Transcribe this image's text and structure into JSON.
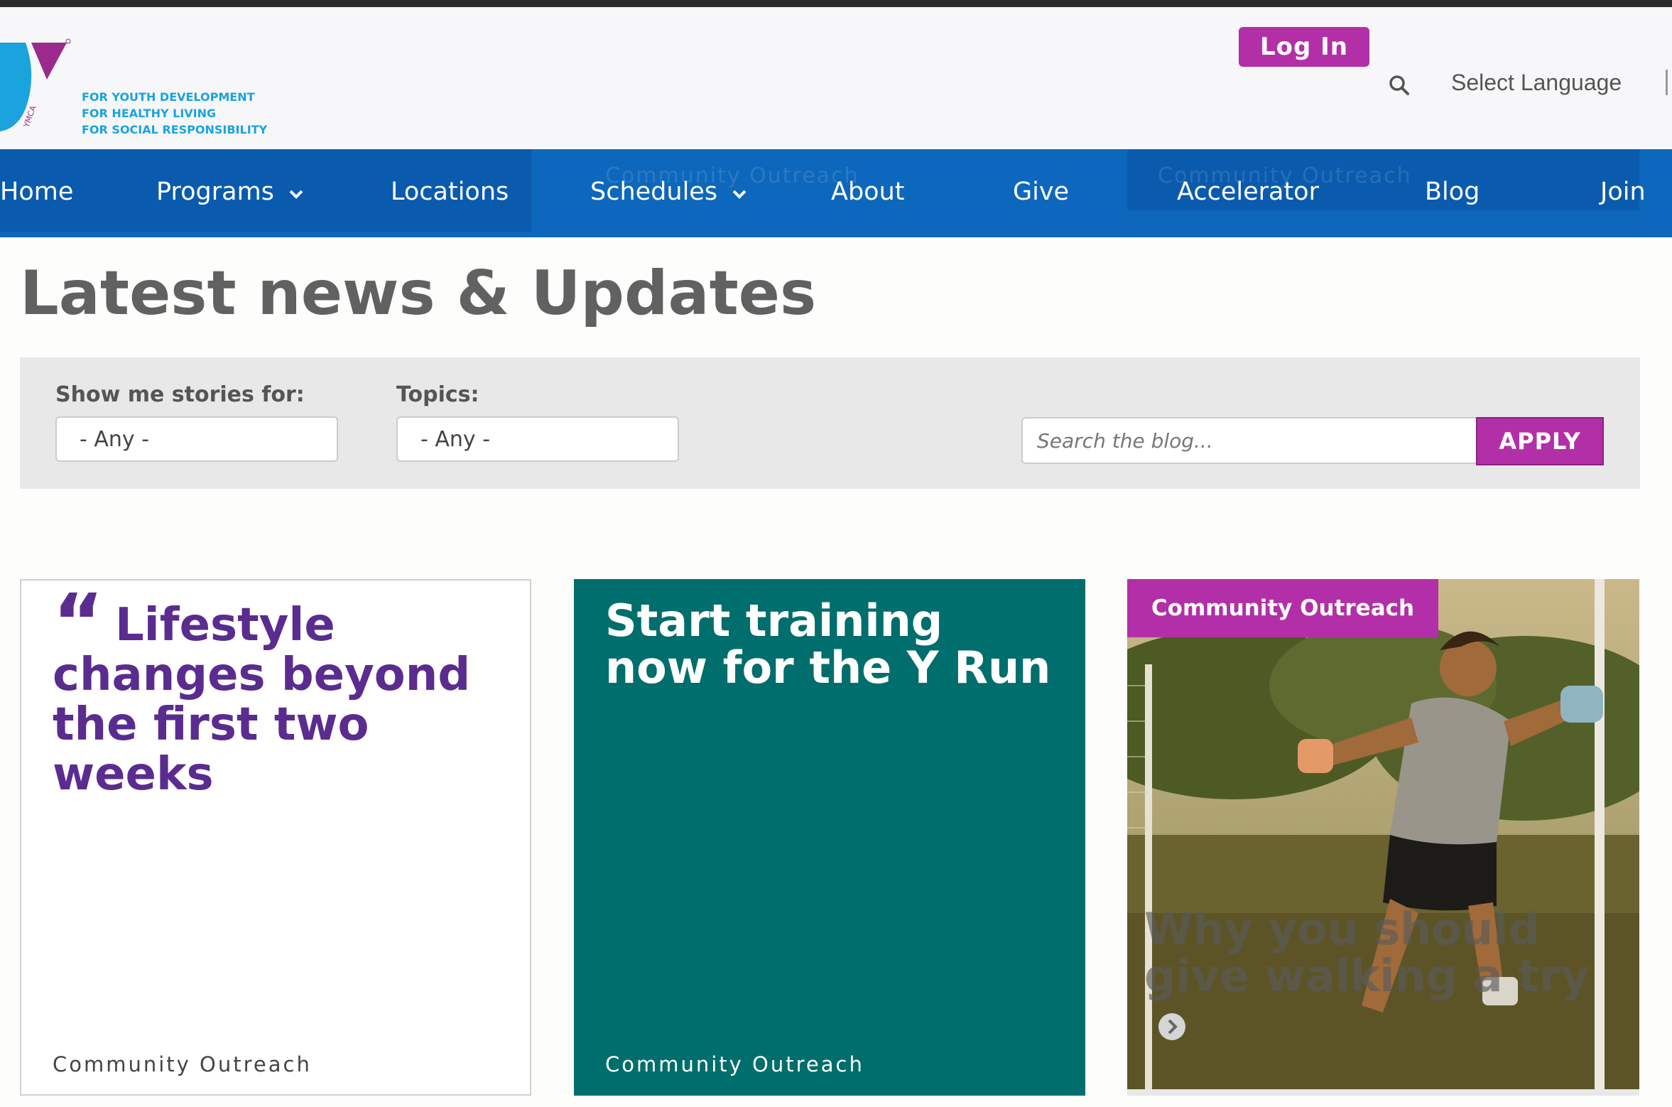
{
  "brand": {
    "tagline": [
      "FOR YOUTH DEVELOPMENT",
      "FOR HEALTHY LIVING",
      "FOR SOCIAL RESPONSIBILITY"
    ],
    "mark_text": "YMCA",
    "colors": {
      "purple": "#b32fa8",
      "blue": "#0d67bc",
      "teal": "#006e6c",
      "quote_purple": "#5b2c8f",
      "cyan": "#1aa3dc"
    }
  },
  "header": {
    "login_label": "Log In",
    "search_icon": "search-icon",
    "language_label": "Select Language"
  },
  "nav": {
    "items": [
      {
        "label": "Home"
      },
      {
        "label": "Programs",
        "dropdown": true
      },
      {
        "label": "Locations"
      },
      {
        "label": "Schedules",
        "dropdown": true
      },
      {
        "label": "About"
      },
      {
        "label": "Give"
      },
      {
        "label": "Accelerator"
      },
      {
        "label": "Blog"
      },
      {
        "label": "Join"
      }
    ],
    "ghost_text": "Community Outreach"
  },
  "page": {
    "title": "Latest news & Updates"
  },
  "filters": {
    "stories_label": "Show me stories for:",
    "stories_value": "- Any -",
    "topics_label": "Topics:",
    "topics_value": "- Any -",
    "search_placeholder": "Search the blog...",
    "apply_label": "APPLY"
  },
  "cards": [
    {
      "title": "Lifestyle changes beyond the first two weeks",
      "quote_mark": "“",
      "category": "Community Outreach"
    },
    {
      "title": "Start training now for the Y Run",
      "category": "Community Outreach"
    },
    {
      "badge": "Community Outreach",
      "title": "Why you should give walking a try",
      "next_icon": "chevron-right-icon"
    }
  ]
}
